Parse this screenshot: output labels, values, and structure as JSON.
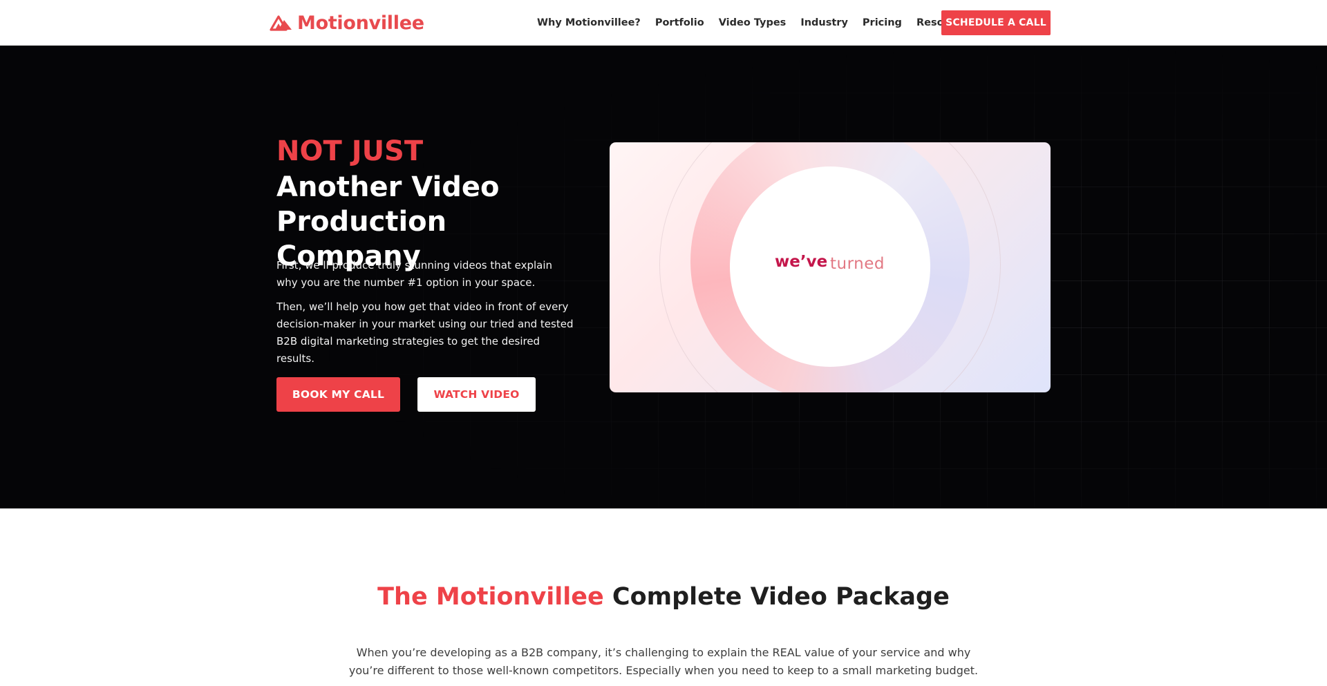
{
  "header": {
    "logo_text": "Motionvillee",
    "nav": [
      {
        "label": "Why Motionvillee?"
      },
      {
        "label": "Portfolio"
      },
      {
        "label": "Video Types"
      },
      {
        "label": "Industry"
      },
      {
        "label": "Pricing"
      },
      {
        "label": "Resources"
      }
    ],
    "cta_label": "SCHEDULE A CALL"
  },
  "hero": {
    "title_red": "NOT JUST",
    "title_line1": "Another Video",
    "title_line2": "Production Company",
    "paragraph1": "First, we’ll produce truly stunning videos that explain why you are the number #1 option in your space.",
    "paragraph2": "Then, we’ll help you how get that video in front of every decision-maker in your market using our tried and tested B2B digital marketing strategies to get the desired results.",
    "book_button": "BOOK MY CALL",
    "watch_button": "WATCH VIDEO",
    "video": {
      "word1": "we’ve",
      "word2": "turned"
    }
  },
  "package": {
    "title_red": "The Motionvillee",
    "title_rest": " Complete Video Package",
    "description": "When you’re developing as a B2B company, it’s challenging to explain the REAL value of your service and why you’re different to those well-known competitors. Especially when you need to keep to a small marketing budget."
  },
  "colors": {
    "brand_red": "#ee4248",
    "hero_bg": "#050507"
  },
  "icons": {
    "logo": "triangle-logo-icon"
  }
}
